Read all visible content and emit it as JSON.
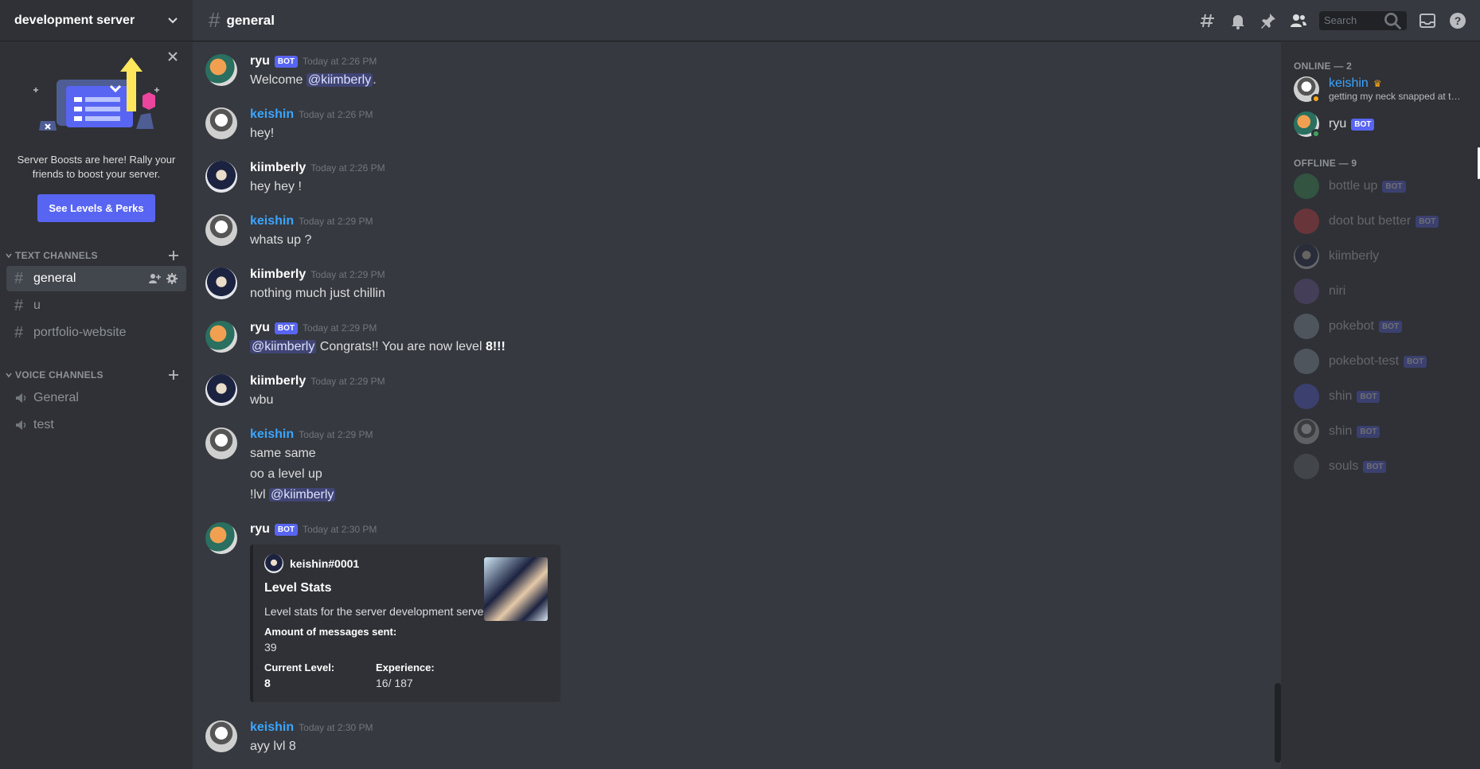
{
  "sidebar": {
    "server_name": "development server",
    "boost": {
      "text": "Server Boosts are here! Rally your friends to boost your server.",
      "button": "See Levels & Perks"
    },
    "text_category": "TEXT CHANNELS",
    "voice_category": "VOICE CHANNELS",
    "text_channels": [
      {
        "name": "general",
        "active": true
      },
      {
        "name": "u"
      },
      {
        "name": "portfolio-website"
      }
    ],
    "voice_channels": [
      {
        "name": "General"
      },
      {
        "name": "test"
      }
    ]
  },
  "header": {
    "channel": "general",
    "search_placeholder": "Search"
  },
  "messages": [
    {
      "author": "ryu",
      "bot": true,
      "time": "Today at 2:26 PM",
      "lines": [
        "Welcome @kiimberly."
      ]
    },
    {
      "author": "keishin",
      "time": "Today at 2:26 PM",
      "lines": [
        "hey!"
      ]
    },
    {
      "author": "kiimberly",
      "time": "Today at 2:26 PM",
      "lines": [
        "hey hey !"
      ]
    },
    {
      "author": "keishin",
      "time": "Today at 2:29 PM",
      "lines": [
        "whats up ?"
      ]
    },
    {
      "author": "kiimberly",
      "time": "Today at 2:29 PM",
      "lines": [
        "nothing much just chillin"
      ]
    },
    {
      "author": "ryu",
      "bot": true,
      "time": "Today at 2:29 PM",
      "mention": "@kiimberly",
      "text_after": " Congrats!! You are now level ",
      "bold": "8!!!"
    },
    {
      "author": "kiimberly",
      "time": "Today at 2:29 PM",
      "lines": [
        "wbu"
      ]
    },
    {
      "author": "keishin",
      "time": "Today at 2:29 PM",
      "lines": [
        "same same",
        "oo a level up"
      ],
      "cmd": "!lvl",
      "cmd_mention": "@kiimberly"
    },
    {
      "author": "ryu",
      "bot": true,
      "time": "Today at 2:30 PM"
    },
    {
      "author": "keishin",
      "time": "Today at 2:30 PM",
      "lines": [
        "ayy lvl 8"
      ]
    }
  ],
  "embed": {
    "author": "keishin#0001",
    "title": "Level Stats",
    "description": "Level stats for the server development server",
    "f1_name": "Amount of messages sent:",
    "f1_value": "39",
    "f2_name": "Current Level:",
    "f2_value": "8",
    "f3_name": "Experience:",
    "f3_value": "16/ 187"
  },
  "bot_label": "BOT",
  "welcome_before": "Welcome ",
  "welcome_mention": "@kiimberly",
  "welcome_after": ".",
  "members": {
    "online_header": "ONLINE — 2",
    "offline_header": "OFFLINE — 9",
    "online": [
      {
        "name": "keishin",
        "status": "getting my neck snapped at thi..."
      },
      {
        "name": "ryu"
      }
    ],
    "offline": [
      "bottle up",
      "doot but better",
      "kiimberly",
      "niri",
      "pokebot",
      "pokebot-test",
      "shin",
      "shin",
      "souls"
    ]
  },
  "colors": {
    "accent": "#5865f2",
    "link_user": "#3ba5ff",
    "online": "#3ba55d",
    "idle": "#faa81a"
  }
}
